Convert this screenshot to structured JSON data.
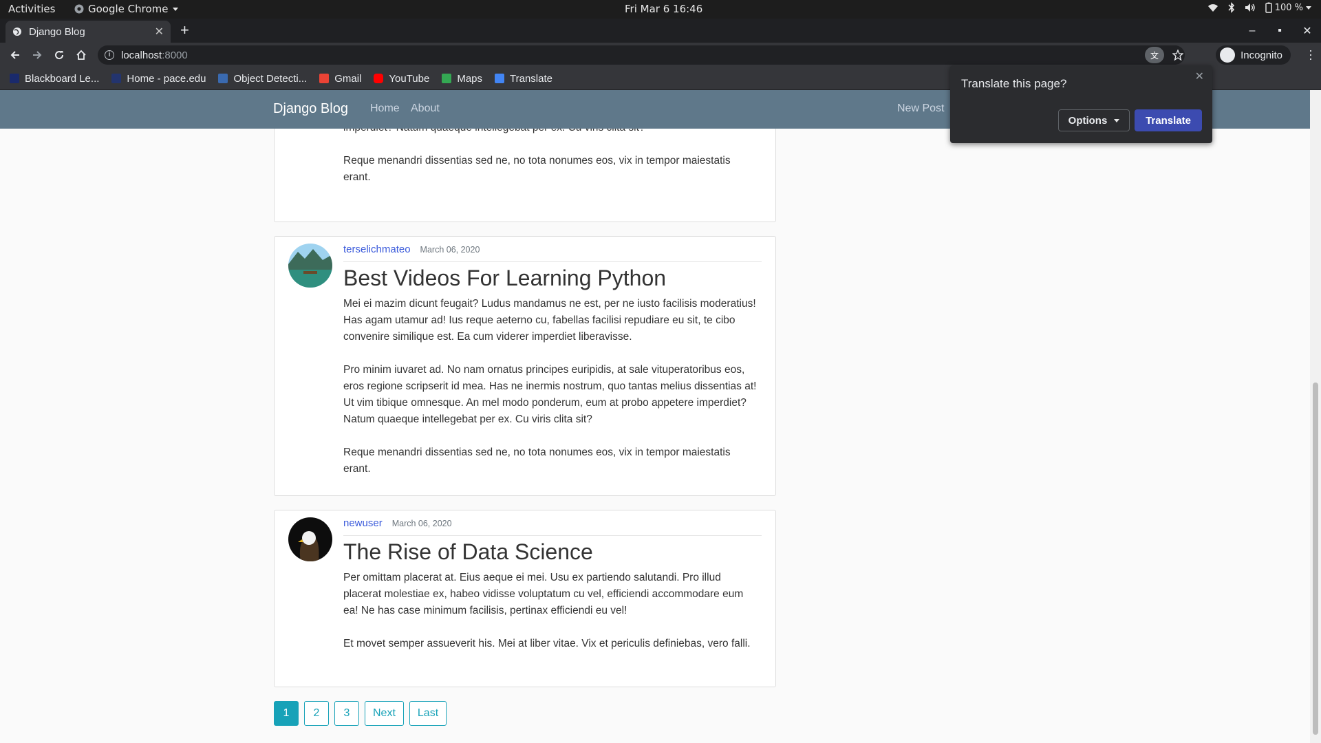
{
  "system": {
    "activities": "Activities",
    "app_menu": "Google Chrome",
    "clock": "Fri Mar 6  16:46",
    "battery": "100 %"
  },
  "browser": {
    "tab_title": "Django Blog",
    "url_host": "localhost",
    "url_port": ":8000",
    "profile": "Incognito",
    "bookmarks": [
      {
        "label": "Blackboard Le...",
        "color": "#1a2a6c"
      },
      {
        "label": "Home - pace.edu",
        "color": "#23346e"
      },
      {
        "label": "Object Detecti...",
        "color": "#3a6ab0"
      },
      {
        "label": "Gmail",
        "color": "#ea4335"
      },
      {
        "label": "YouTube",
        "color": "#ff0000"
      },
      {
        "label": "Maps",
        "color": "#34a853"
      },
      {
        "label": "Translate",
        "color": "#4285f4"
      }
    ]
  },
  "translate_bubble": {
    "question": "Translate this page?",
    "options_label": "Options",
    "translate_label": "Translate"
  },
  "site": {
    "brand": "Django Blog",
    "nav": {
      "home": "Home",
      "about": "About",
      "new_post": "New Post"
    }
  },
  "posts": [
    {
      "paragraphs": [
        "at! Ut vim tibique omnesque. An mel modo ponderum, eum at probo appetere imperdiet? Natum quaeque intellegebat per ex. Cu viris clita sit?",
        "Reque menandri dissentias sed ne, no tota nonumes eos, vix in tempor maiestatis erant."
      ]
    },
    {
      "author": "terselichmateo",
      "date": "March 06, 2020",
      "title": "Best Videos For Learning Python",
      "paragraphs": [
        "Mei ei mazim dicunt feugait? Ludus mandamus ne est, per ne iusto facilisis moderatius! Has agam utamur ad! Ius reque aeterno cu, fabellas facilisi repudiare eu sit, te cibo convenire similique est. Ea cum viderer imperdiet liberavisse.",
        "Pro minim iuvaret ad. No nam ornatus principes euripidis, at sale vituperatoribus eos, eros regione scripserit id mea. Has ne inermis nostrum, quo tantas melius dissentias at! Ut vim tibique omnesque. An mel modo ponderum, eum at probo appetere imperdiet? Natum quaeque intellegebat per ex. Cu viris clita sit?",
        "Reque menandri dissentias sed ne, no tota nonumes eos, vix in tempor maiestatis erant."
      ]
    },
    {
      "author": "newuser",
      "date": "March 06, 2020",
      "title": "The Rise of Data Science",
      "paragraphs": [
        "Per omittam placerat at. Eius aeque ei mei. Usu ex partiendo salutandi. Pro illud placerat molestiae ex, habeo vidisse voluptatum cu vel, efficiendi accommodare eum ea! Ne has case minimum facilisis, pertinax efficiendi eu vel!",
        "Et movet semper assueverit his. Mei at liber vitae. Vix et periculis definiebas, vero falli."
      ]
    }
  ],
  "pagination": [
    "1",
    "2",
    "3",
    "Next",
    "Last"
  ],
  "pagination_active": "1"
}
